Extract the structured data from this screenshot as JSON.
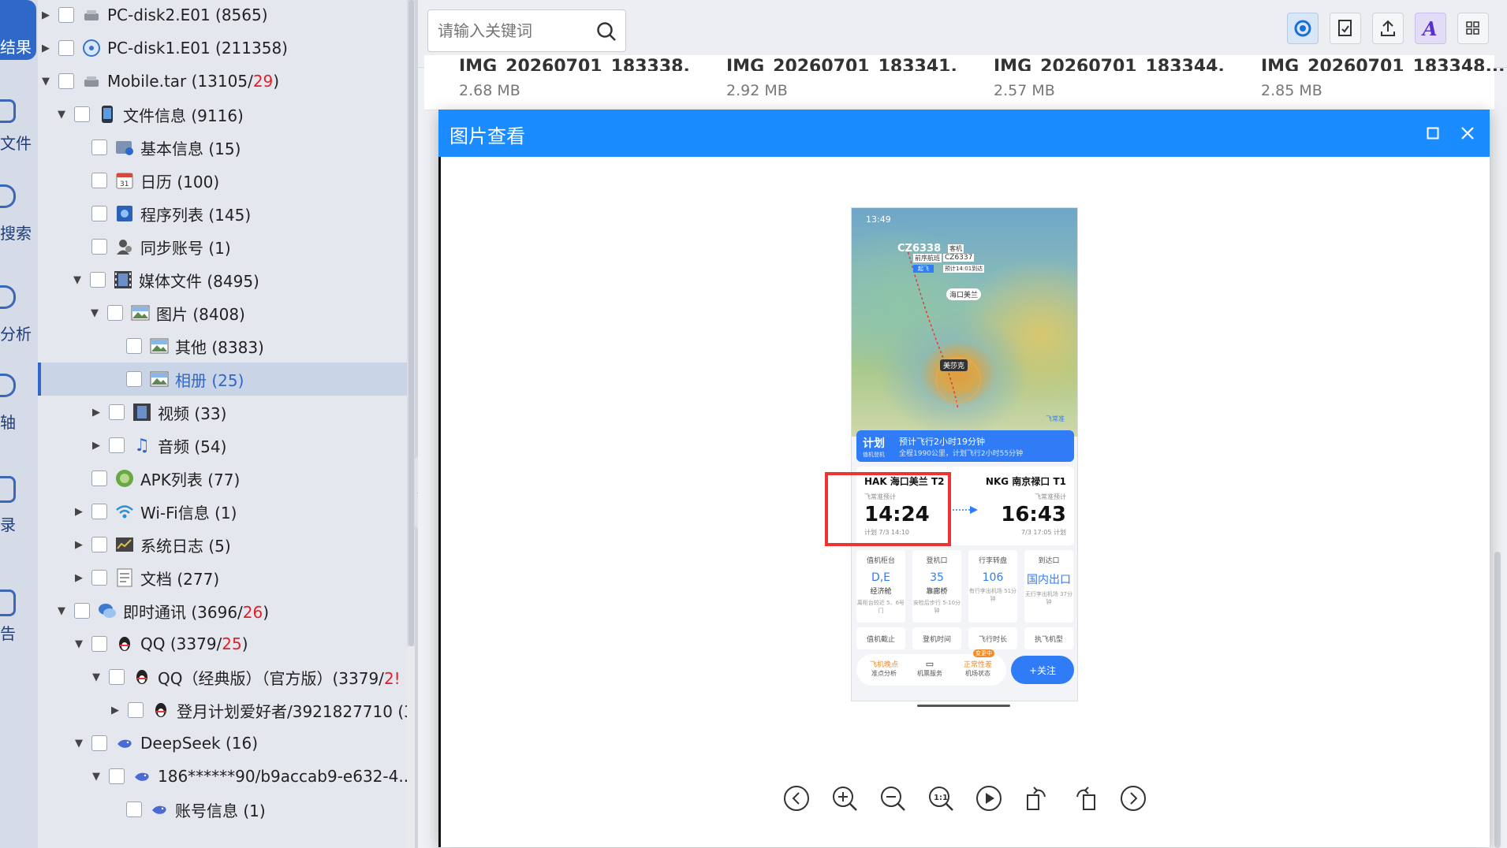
{
  "rail": {
    "items": [
      {
        "label": "结果"
      },
      {
        "label": "文件"
      },
      {
        "label": "搜索"
      },
      {
        "label": "分析"
      },
      {
        "label": "轴"
      },
      {
        "label": "录"
      },
      {
        "label": "告"
      }
    ]
  },
  "tree": {
    "rows": [
      {
        "label": "PC-disk2.E01 (8565)"
      },
      {
        "label": "PC-disk1.E01 (211358)"
      },
      {
        "label": "Mobile.tar (13105/",
        "red": "29",
        "tail": ")"
      },
      {
        "label": "文件信息 (9116)"
      },
      {
        "label": "基本信息 (15)"
      },
      {
        "label": "日历 (100)"
      },
      {
        "label": "程序列表 (145)"
      },
      {
        "label": "同步账号 (1)"
      },
      {
        "label": "媒体文件 (8495)"
      },
      {
        "label": "图片 (8408)"
      },
      {
        "label": "其他 (8383)"
      },
      {
        "label": "相册 (25)"
      },
      {
        "label": "视频 (33)"
      },
      {
        "label": "音频 (54)"
      },
      {
        "label": "APK列表 (77)"
      },
      {
        "label": "Wi-Fi信息 (1)"
      },
      {
        "label": "系统日志 (5)"
      },
      {
        "label": "文档 (277)"
      },
      {
        "label": "即时通讯 (3696/",
        "red": "26",
        "tail": ")"
      },
      {
        "label": "QQ (3379/",
        "red": "25",
        "tail": ")"
      },
      {
        "label": "QQ（经典版）（官方版）(3379/",
        "red": "2!",
        "tail": ""
      },
      {
        "label": "登月计划爱好者/3921827710 (3:"
      },
      {
        "label": "DeepSeek (16)"
      },
      {
        "label": "186******90/b9accab9-e632-4..."
      },
      {
        "label": "账号信息 (1)"
      }
    ]
  },
  "search": {
    "placeholder": "请输入关键词"
  },
  "thumbs": [
    {
      "name": "IMG_20260701_183338...",
      "size": "2.68 MB"
    },
    {
      "name": "IMG_20260701_183341...",
      "size": "2.92 MB"
    },
    {
      "name": "IMG_20260701_183344...",
      "size": "2.57 MB"
    },
    {
      "name": "IMG_20260701_183348...",
      "size": "2.85 MB"
    }
  ],
  "viewer": {
    "title": "图片查看"
  },
  "phone": {
    "status_time": "13:49",
    "flight_no": "CZ6338",
    "map_labels": {
      "tag_top": "客机",
      "tag_code": "CZ6337",
      "tag_sub": "前序航班",
      "tag_takeoff": "起飞",
      "tag_time": "预计14:01到达",
      "airport_marker": "海口美兰",
      "typhoon": "美莎克",
      "feichangzhun": "飞常准"
    },
    "plan": {
      "label": "计划",
      "sub": "值机登机",
      "main": "预计飞行2小时19分钟",
      "detail": "全程1990公里，计划飞行2小时55分钟"
    },
    "dep": {
      "airport": "HAK 海口美兰 T2",
      "small": "飞常准预计",
      "time": "14:24",
      "plan": "计划 7/3 14:10"
    },
    "arr": {
      "airport": "NKG 南京禄口 T1",
      "small": "飞常准预计",
      "time": "16:43",
      "plan": "7/3 17:05 计划"
    },
    "grid": [
      {
        "h": "值机柜台",
        "v": "D,E",
        "s1": "经济舱",
        "s2": "离柜台较近 5、6号门"
      },
      {
        "h": "登机口",
        "v": "35",
        "s1": "靠廊桥",
        "s2": "安检后步行 5-10分钟"
      },
      {
        "h": "行李转盘",
        "v": "106",
        "s1": "",
        "s2": "有行李出机场 51分钟"
      },
      {
        "h": "到达口",
        "v": "国内出口",
        "s1": "",
        "s2": "无行李出机场 37分钟"
      }
    ],
    "bottom_row": [
      "值机截止",
      "登机时间",
      "飞行时长",
      "执飞机型"
    ],
    "bar": {
      "item1_top": "飞机晚点",
      "item1_bot": "准点分析",
      "item2_bot": "机票服务",
      "item3_badge": "变更中",
      "item3_top": "正常性差",
      "item3_bot": "机场状态",
      "follow": "+关注"
    }
  },
  "colors": {
    "accent": "#1a8cff",
    "red_count": "#e0202a",
    "selected_text": "#2f68c8"
  }
}
